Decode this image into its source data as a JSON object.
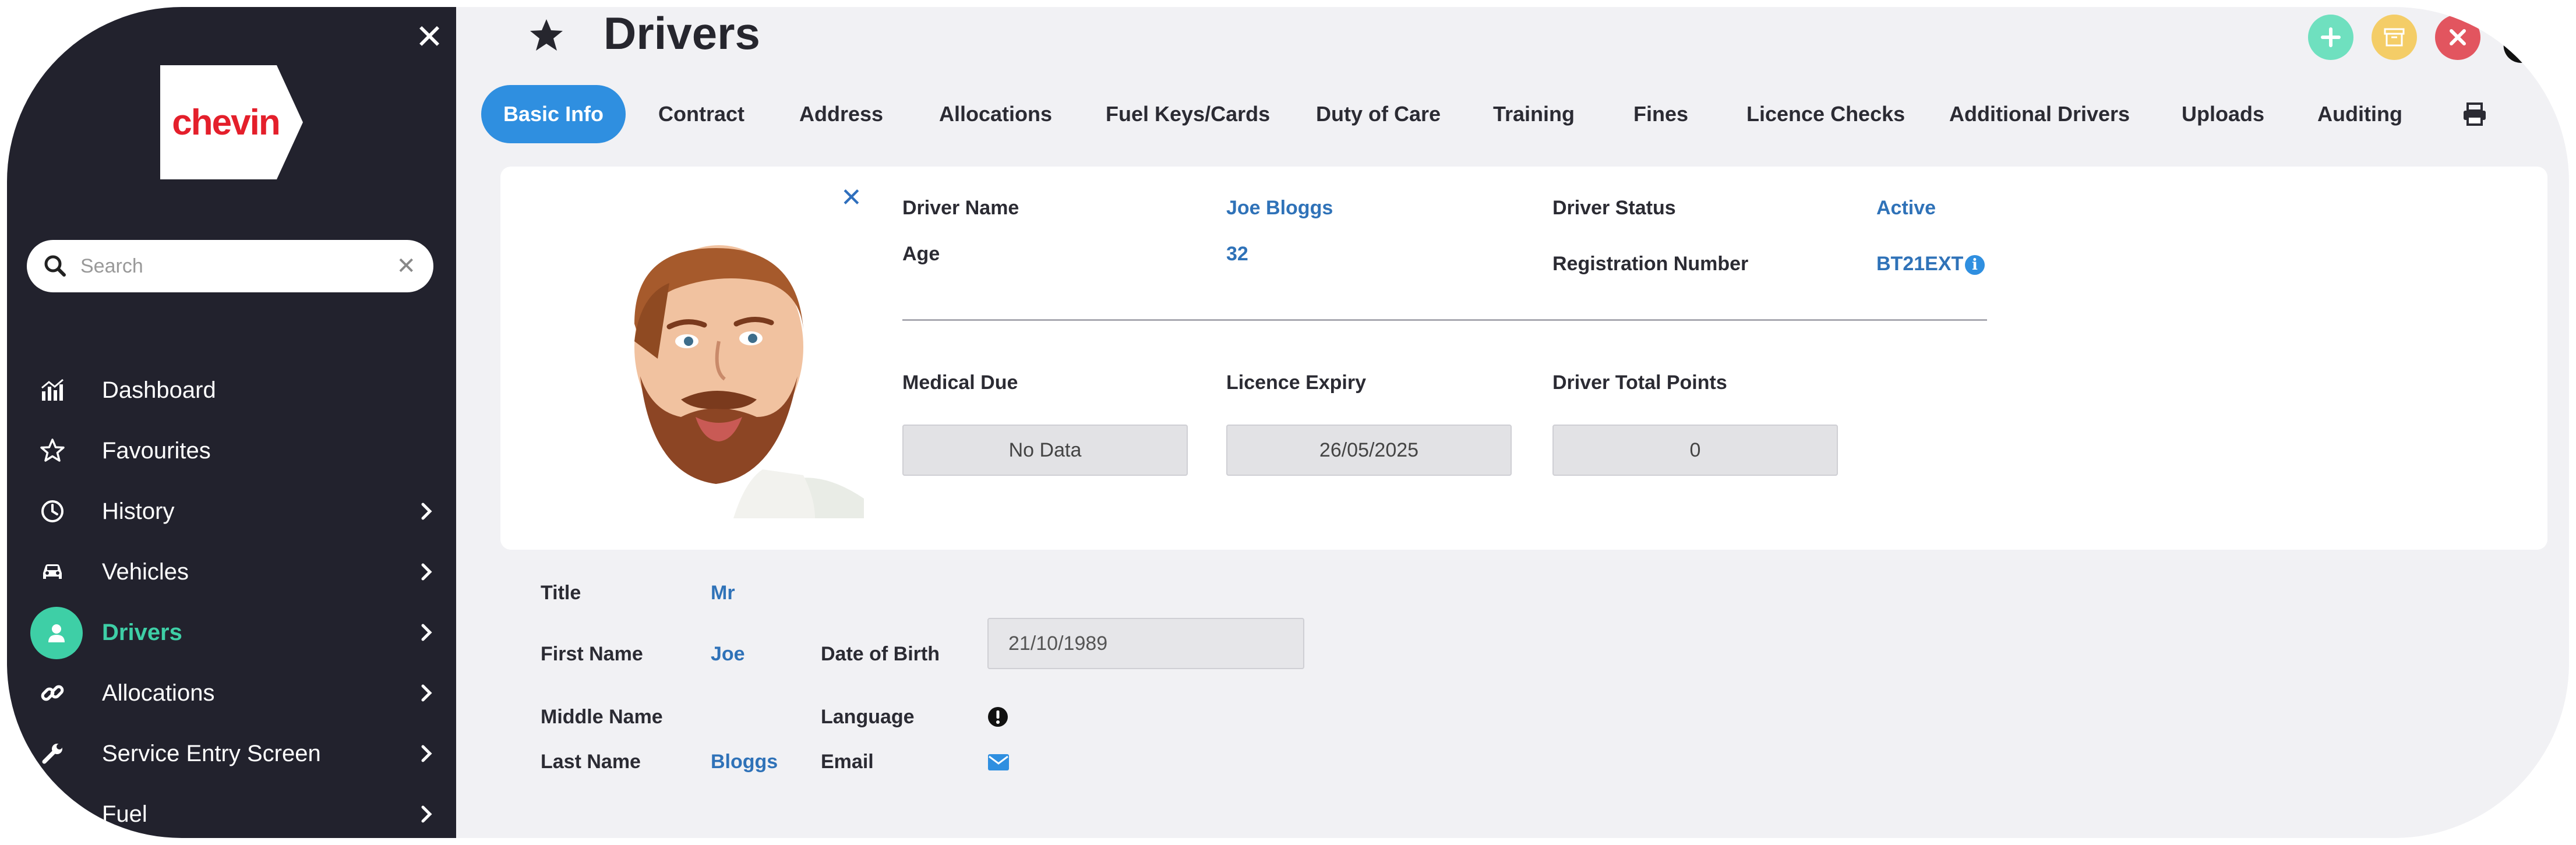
{
  "app": {
    "logo_text": "chevin"
  },
  "sidebar": {
    "search_placeholder": "Search",
    "items": [
      {
        "label": "Dashboard",
        "icon": "dashboard-icon",
        "has_children": false,
        "active": false
      },
      {
        "label": "Favourites",
        "icon": "star-outline-icon",
        "has_children": false,
        "active": false
      },
      {
        "label": "History",
        "icon": "clock-icon",
        "has_children": true,
        "active": false
      },
      {
        "label": "Vehicles",
        "icon": "car-icon",
        "has_children": true,
        "active": false
      },
      {
        "label": "Drivers",
        "icon": "user-icon",
        "has_children": true,
        "active": true
      },
      {
        "label": "Allocations",
        "icon": "link-icon",
        "has_children": true,
        "active": false
      },
      {
        "label": "Service Entry Screen",
        "icon": "wrench-icon",
        "has_children": true,
        "active": false
      },
      {
        "label": "Fuel",
        "icon": "fuel-icon",
        "has_children": true,
        "active": false
      }
    ]
  },
  "header": {
    "title": "Drivers",
    "actions": [
      "add-icon",
      "archive-icon",
      "close-icon"
    ]
  },
  "tabs": [
    {
      "label": "Basic Info",
      "active": true
    },
    {
      "label": "Contract"
    },
    {
      "label": "Address"
    },
    {
      "label": "Allocations"
    },
    {
      "label": "Fuel Keys/Cards"
    },
    {
      "label": "Duty of Care"
    },
    {
      "label": "Training"
    },
    {
      "label": "Fines"
    },
    {
      "label": "Licence Checks"
    },
    {
      "label": "Additional Drivers"
    },
    {
      "label": "Uploads"
    },
    {
      "label": "Auditing"
    }
  ],
  "summary": {
    "driver_name_label": "Driver Name",
    "driver_name": "Joe Bloggs",
    "age_label": "Age",
    "age": "32",
    "driver_status_label": "Driver Status",
    "driver_status": "Active",
    "registration_label": "Registration Number",
    "registration": "BT21EXT",
    "medical_due_label": "Medical Due",
    "medical_due": "No Data",
    "licence_expiry_label": "Licence Expiry",
    "licence_expiry": "26/05/2025",
    "total_points_label": "Driver Total Points",
    "total_points": "0"
  },
  "details": {
    "title_label": "Title",
    "title": "Mr",
    "first_name_label": "First Name",
    "first_name": "Joe",
    "dob_label": "Date of Birth",
    "dob": "21/10/1989",
    "middle_name_label": "Middle Name",
    "middle_name": "",
    "language_label": "Language",
    "last_name_label": "Last Name",
    "last_name": "Bloggs",
    "email_label": "Email"
  },
  "colors": {
    "sidebar_bg": "#22222d",
    "accent": "#3ecfa6",
    "primary": "#2f8fe0",
    "link_value": "#2f72b8",
    "logo_red": "#e41f2b"
  }
}
